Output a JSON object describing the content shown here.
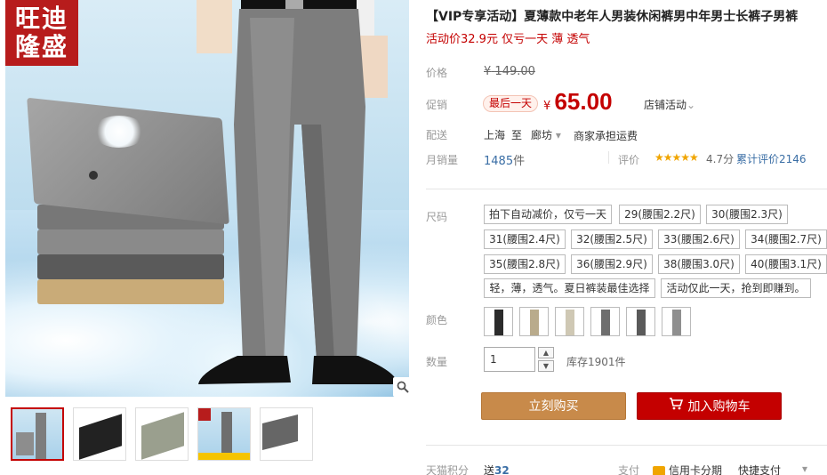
{
  "brand": {
    "line1": "旺迪",
    "line2": "隆盛"
  },
  "product": {
    "title": "【VIP专享活动】夏薄款中老年人男装休闲裤男中年男士长裤子男裤",
    "subtitle": "活动价32.9元 仅亏一天 薄 透气"
  },
  "price": {
    "label": "价格",
    "currency": "¥",
    "original": "149.00",
    "promo_label": "促销",
    "promo_badge": "最后一天",
    "current": "65.00",
    "shop_activity": "店铺活动",
    "shop_activity_caret": "⌄"
  },
  "shipping": {
    "label": "配送",
    "from": "上海",
    "to_word": "至",
    "dest": "廊坊",
    "dest_caret": "▾",
    "fee": "商家承担运费"
  },
  "stats": {
    "sales_label": "月销量",
    "sales_value": "1485",
    "sales_unit": "件",
    "rating_label": "评价",
    "stars": "★★★★★",
    "score": "4.7分",
    "review_text": "累计评价2146"
  },
  "size": {
    "label": "尺码",
    "options": [
      "拍下自动减价，仅亏一天",
      "29(腰围2.2尺)",
      "30(腰围2.3尺)",
      "31(腰围2.4尺)",
      "32(腰围2.5尺)",
      "33(腰围2.6尺)",
      "34(腰围2.7尺)",
      "35(腰围2.8尺)",
      "36(腰围2.9尺)",
      "38(腰围3.0尺)",
      "40(腰围3.1尺)",
      "轻，薄，透气。夏日裤装最佳选择",
      "活动仅此一天，抢到即赚到。"
    ]
  },
  "color": {
    "label": "颜色",
    "swatch_colors": [
      "#2b2b2b",
      "#b9ab8c",
      "#cfc8b4",
      "#6e6e6e",
      "#5a5a5a",
      "#8f8f8f"
    ]
  },
  "quantity": {
    "label": "数量",
    "value": "1",
    "up": "▲",
    "down": "▼",
    "stock": "库存1901件"
  },
  "actions": {
    "buy": "立刻购买",
    "cart": "加入购物车"
  },
  "bottom": {
    "points_label": "天猫积分",
    "points_prefix": "送",
    "points_value": "32",
    "pay_label": "支付",
    "credit": "信用卡分期",
    "quick": "快捷支付",
    "more": "▾"
  },
  "colors": {
    "accent": "#c40000",
    "buy": "#c88a4a",
    "link": "#3a6ea5",
    "star": "#f0a500"
  }
}
